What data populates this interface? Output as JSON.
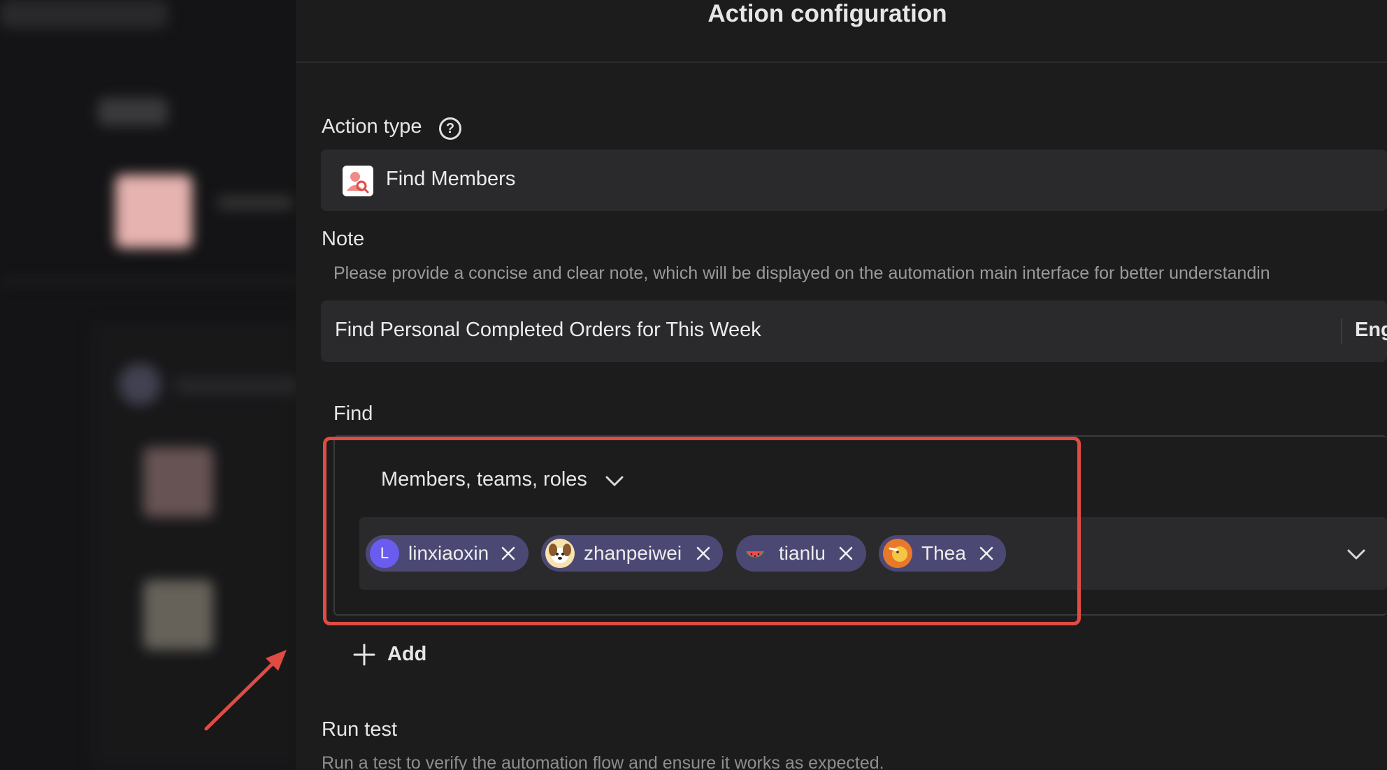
{
  "panel": {
    "title": "Action configuration"
  },
  "action_type": {
    "label": "Action type",
    "value": "Find Members"
  },
  "note": {
    "label": "Note",
    "helper": "Please provide a concise and clear note, which will be displayed on the automation main interface for better understandin",
    "value": "Find Personal Completed Orders for This Week",
    "language": "Eng"
  },
  "find": {
    "label": "Find",
    "scope_dropdown": "Members, teams, roles",
    "members": [
      {
        "name": "linxiaoxin",
        "avatar_initial": "L",
        "avatar_color": "#6b5cf0"
      },
      {
        "name": "zhanpeiwei",
        "avatar_initial": "",
        "avatar_color": "#f2c94c"
      },
      {
        "name": "tianlu",
        "avatar_initial": "",
        "avatar_color": "#4c4874"
      },
      {
        "name": "Thea",
        "avatar_initial": "",
        "avatar_color": "#e8792a"
      }
    ]
  },
  "add_button": {
    "label": "Add"
  },
  "run_test": {
    "label": "Run test",
    "helper": "Run a test to verify the automation flow and ensure it works as expected."
  },
  "colors": {
    "highlight": "#e04b44",
    "chip_bg": "#4c4874",
    "panel_bg": "#1c1c1d",
    "field_bg": "#2a2a2c"
  }
}
